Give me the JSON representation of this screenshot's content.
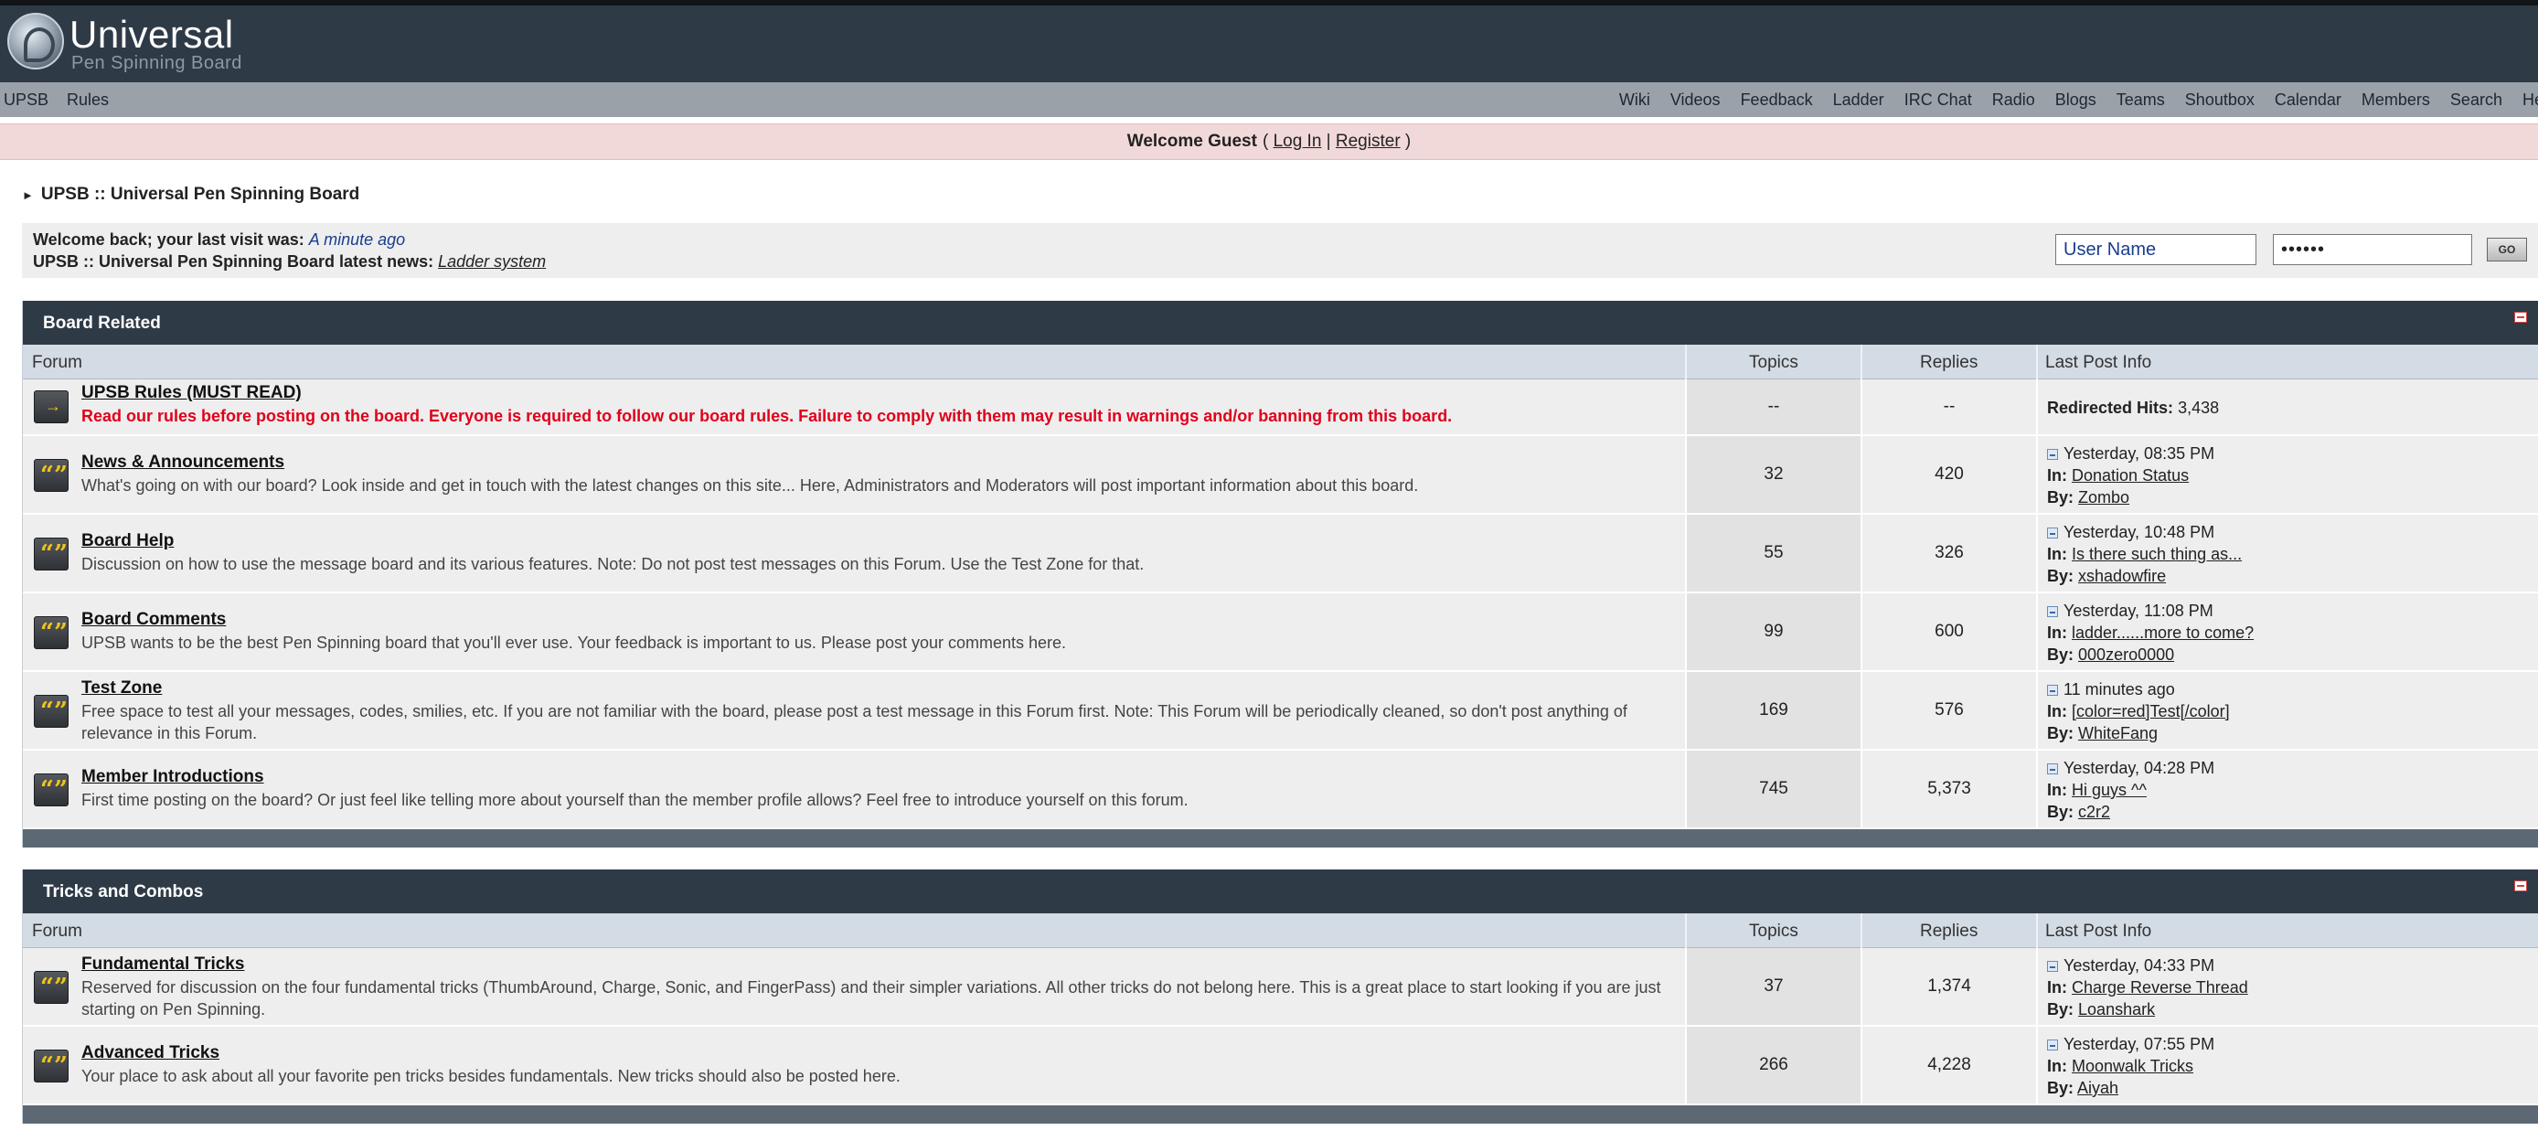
{
  "header": {
    "logo_title": "Universal",
    "logo_subtitle": "Pen Spinning Board"
  },
  "nav": {
    "left": [
      "UPSB",
      "Rules"
    ],
    "right": [
      "Wiki",
      "Videos",
      "Feedback",
      "Ladder",
      "IRC Chat",
      "Radio",
      "Blogs",
      "Teams",
      "Shoutbox",
      "Calendar",
      "Members",
      "Search",
      "Help"
    ]
  },
  "welcome": {
    "label": "Welcome Guest",
    "open": "(",
    "login": "Log In",
    "divider": "|",
    "register": "Register",
    "close": ")"
  },
  "breadcrumb": {
    "text": "UPSB :: Universal Pen Spinning Board"
  },
  "info": {
    "last_visit_label": "Welcome back; your last visit was:",
    "last_visit_value": "A minute ago",
    "news_label": "UPSB :: Universal Pen Spinning Board latest news:",
    "news_value": "Ladder system",
    "username_value": "User Name",
    "password_value": "••••••",
    "go_label": "GO"
  },
  "columns": {
    "forum": "Forum",
    "topics": "Topics",
    "replies": "Replies",
    "last_post": "Last Post Info"
  },
  "last_post_labels": {
    "in": "In:",
    "by": "By:",
    "redirected": "Redirected Hits:"
  },
  "categories": [
    {
      "title": "Board Related",
      "forums": [
        {
          "name": "UPSB Rules (MUST READ)",
          "desc": "Read our rules before posting on the board. Everyone is required to follow our board rules. Failure to comply with them may result in warnings and/or banning from this board.",
          "topics": "--",
          "replies": "--",
          "redirect_hits": "3,438"
        },
        {
          "name": "News & Announcements",
          "desc": "What's going on with our board? Look inside and get in touch with the latest changes on this site... Here, Administrators and Moderators will post important information about this board.",
          "topics": "32",
          "replies": "420",
          "last_time": "Yesterday, 08:35 PM",
          "last_in": "Donation Status",
          "last_by": "Zombo"
        },
        {
          "name": "Board Help",
          "desc": "Discussion on how to use the message board and its various features. Note: Do not post test messages on this Forum. Use the Test Zone for that.",
          "topics": "55",
          "replies": "326",
          "last_time": "Yesterday, 10:48 PM",
          "last_in": "Is there such thing as...",
          "last_by": "xshadowfire"
        },
        {
          "name": "Board Comments",
          "desc": "UPSB wants to be the best Pen Spinning board that you'll ever use. Your feedback is important to us. Please post your comments here.",
          "topics": "99",
          "replies": "600",
          "last_time": "Yesterday, 11:08 PM",
          "last_in": "ladder......more to come?",
          "last_by": "000zero0000"
        },
        {
          "name": "Test Zone",
          "desc": "Free space to test all your messages, codes, smilies, etc. If you are not familiar with the board, please post a test message in this Forum first. Note: This Forum will be periodically cleaned, so don't post anything of relevance in this Forum.",
          "topics": "169",
          "replies": "576",
          "last_time": "11 minutes ago",
          "last_in": "[color=red]Test[/color]",
          "last_by": "WhiteFang"
        },
        {
          "name": "Member Introductions",
          "desc": "First time posting on the board? Or just feel like telling more about yourself than the member profile allows? Feel free to introduce yourself on this forum.",
          "topics": "745",
          "replies": "5,373",
          "last_time": "Yesterday, 04:28 PM",
          "last_in": "Hi guys ^^",
          "last_by": "c2r2"
        }
      ]
    },
    {
      "title": "Tricks and Combos",
      "forums": [
        {
          "name": "Fundamental Tricks",
          "desc": "Reserved for discussion on the four fundamental tricks (ThumbAround, Charge, Sonic, and FingerPass) and their simpler variations. All other tricks do not belong here. This is a great place to start looking if you are just starting on Pen Spinning.",
          "topics": "37",
          "replies": "1,374",
          "last_time": "Yesterday, 04:33 PM",
          "last_in": "Charge Reverse Thread",
          "last_by": "Loanshark"
        },
        {
          "name": "Advanced Tricks",
          "desc": "Your place to ask about all your favorite pen tricks besides fundamentals. New tricks should also be posted here.",
          "topics": "266",
          "replies": "4,228",
          "last_time": "Yesterday, 07:55 PM",
          "last_in": "Moonwalk Tricks",
          "last_by": "Aiyah"
        }
      ]
    }
  ]
}
